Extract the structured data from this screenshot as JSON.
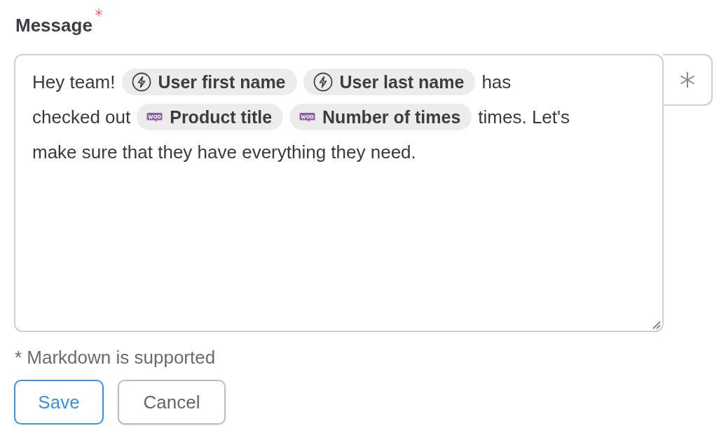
{
  "field": {
    "label": "Message",
    "required": true
  },
  "message_lines": [
    [
      {
        "kind": "text",
        "text": "Hey team!"
      },
      {
        "kind": "trigger_tag",
        "text": "User first name"
      },
      {
        "kind": "trigger_tag",
        "text": "User last name"
      },
      {
        "kind": "text",
        "text": "has"
      }
    ],
    [
      {
        "kind": "text",
        "text": "checked out"
      },
      {
        "kind": "woo_tag",
        "text": "Product title"
      },
      {
        "kind": "woo_tag",
        "text": "Number of times"
      },
      {
        "kind": "text",
        "text": "times. Let's"
      }
    ],
    [
      {
        "kind": "text",
        "text": "make sure that they have everything they need."
      }
    ]
  ],
  "help_text": "* Markdown is supported",
  "buttons": [
    {
      "label": "Save",
      "kind": "primary"
    },
    {
      "label": "Cancel",
      "kind": "secondary"
    }
  ]
}
